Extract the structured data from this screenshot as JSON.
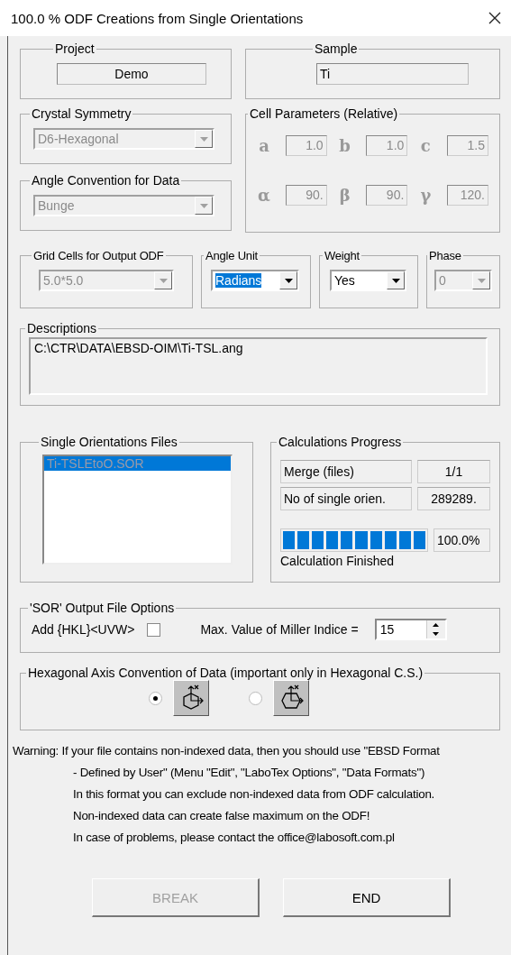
{
  "window": {
    "title": "100.0 % ODF Creations from Single Orientations"
  },
  "project": {
    "label": "Project",
    "value": "Demo"
  },
  "sample": {
    "label": "Sample",
    "value": "Ti"
  },
  "crystal_symmetry": {
    "label": "Crystal Symmetry",
    "value": "D6-Hexagonal",
    "disabled": true
  },
  "angle_convention": {
    "label": "Angle Convention for Data",
    "value": "Bunge",
    "disabled": true
  },
  "cell_parameters": {
    "label": "Cell Parameters (Relative)",
    "disabled": true,
    "params": [
      {
        "symbol": "a",
        "value": "1.0"
      },
      {
        "symbol": "b",
        "value": "1.0"
      },
      {
        "symbol": "c",
        "value": "1.5"
      },
      {
        "symbol": "α",
        "value": "90."
      },
      {
        "symbol": "β",
        "value": "90."
      },
      {
        "symbol": "γ",
        "value": "120."
      }
    ]
  },
  "options": [
    {
      "label": "Grid Cells for Output ODF",
      "value": "5.0*5.0",
      "disabled": true,
      "highlighted": false
    },
    {
      "label": "Angle Unit",
      "value": "Radians",
      "disabled": false,
      "highlighted": true
    },
    {
      "label": "Weight",
      "value": "Yes",
      "disabled": false,
      "highlighted": false
    },
    {
      "label": "Phase",
      "value": "0",
      "disabled": true,
      "highlighted": false
    }
  ],
  "descriptions": {
    "label": "Descriptions",
    "value": "C:\\CTR\\DATA\\EBSD-OIM\\Ti-TSL.ang"
  },
  "files": {
    "label": "Single Orientations Files",
    "items": [
      {
        "name": "Ti-TSLEtoO.SOR",
        "selected": true
      }
    ]
  },
  "progress": {
    "label": "Calculations Progress",
    "rows": [
      {
        "label": "Merge (files)",
        "value": "1/1"
      },
      {
        "label": "No of single orien.",
        "value": "289289."
      }
    ],
    "level": 1,
    "reading": "100.0%",
    "status": "Calculation Finished"
  },
  "sor_options": {
    "label": "'SOR' Output File Options",
    "add_label": "Add {HKL}<UVW>",
    "add_checked": false,
    "max_label": "Max. Value of Miller Indice =",
    "max_value": "15"
  },
  "hex_convention": {
    "label": "Hexagonal Axis Convention of  Data (important only in Hexagonal C.S.)",
    "options": [
      {
        "selected": true
      },
      {
        "selected": false
      }
    ]
  },
  "warning": [
    "Warning: If your file contains non-indexed data, then  you should use \"EBSD Format",
    "- Defined by User\" (Menu \"Edit\", \"LaboTex Options\", \"Data Formats\")",
    "In this format you can exclude non-indexed data from ODF calculation.",
    "Non-indexed data can create false maximum on the ODF!",
    "In case of problems, please contact the office@labosoft.com.pl"
  ],
  "buttons": [
    {
      "label": "BREAK",
      "disabled": true
    },
    {
      "label": "END",
      "disabled": false
    }
  ]
}
